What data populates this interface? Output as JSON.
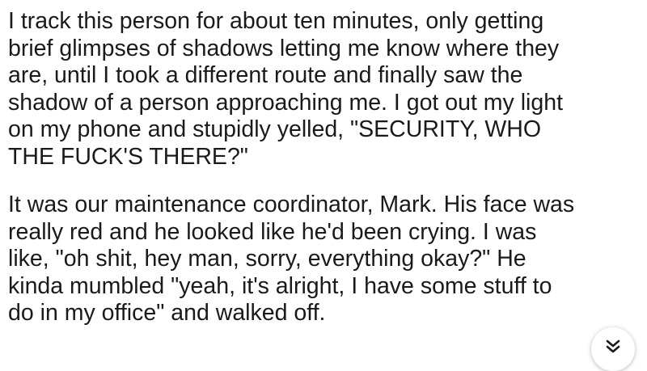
{
  "post": {
    "paragraphs": [
      {
        "lines": [
          "I track this person for about ten minutes, only getting",
          "brief glimpses of shadows letting me know where they",
          "are, until I took a different route and finally saw the",
          "shadow of a person approaching me. I got out my light",
          "on my phone and stupidly yelled, \"SECURITY, WHO",
          "THE FUCK'S THERE?\""
        ]
      },
      {
        "lines": [
          "It was our maintenance coordinator, Mark. His face was",
          "really red and he looked like he'd been crying. I was",
          "like, \"oh shit, hey man, sorry, everything okay?\" He",
          "kinda mumbled \"yeah, it's alright, I have some stuff to",
          "do in my office\" and walked off."
        ]
      }
    ]
  },
  "scroll_button": {
    "icon": "double-chevron-down-icon"
  }
}
